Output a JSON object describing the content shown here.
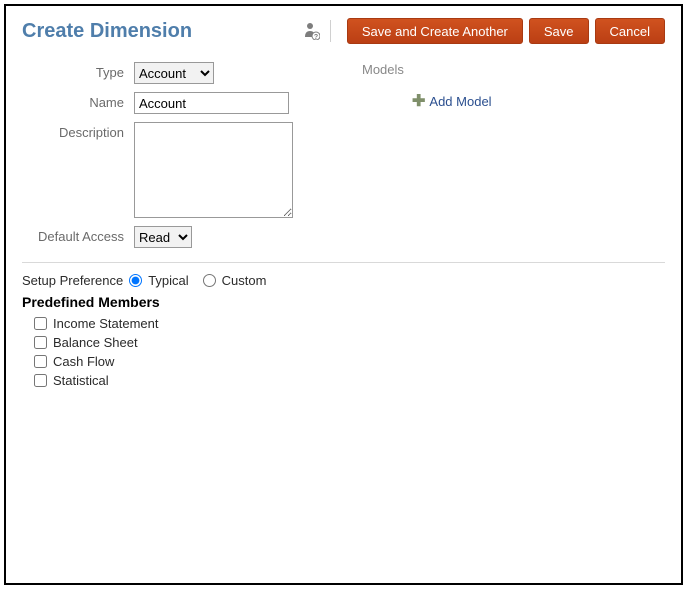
{
  "header": {
    "title": "Create Dimension",
    "buttons": {
      "save_another": "Save and Create Another",
      "save": "Save",
      "cancel": "Cancel"
    }
  },
  "form": {
    "labels": {
      "type": "Type",
      "name": "Name",
      "description": "Description",
      "default_access": "Default Access"
    },
    "type_value": "Account",
    "name_value": "Account",
    "description_value": "",
    "default_access_value": "Read"
  },
  "models": {
    "heading": "Models",
    "add_label": "Add Model"
  },
  "setup": {
    "label": "Setup Preference",
    "options": {
      "typical": "Typical",
      "custom": "Custom"
    },
    "selected": "typical"
  },
  "members": {
    "heading": "Predefined Members",
    "items": [
      {
        "label": "Income Statement"
      },
      {
        "label": "Balance Sheet"
      },
      {
        "label": "Cash Flow"
      },
      {
        "label": "Statistical"
      }
    ]
  }
}
